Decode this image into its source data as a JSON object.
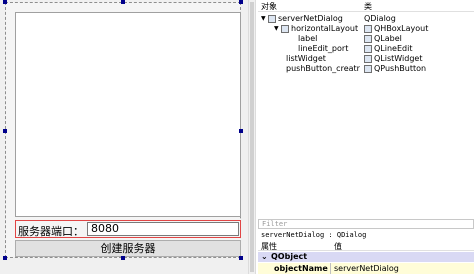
{
  "form": {
    "port_label": "服务器端口：",
    "port_value": "8080",
    "create_button": "创建服务器"
  },
  "object_inspector": {
    "col_object": "对象",
    "col_class": "类",
    "rows": [
      {
        "name": "serverNetDialog",
        "cls": "QDialog"
      },
      {
        "name": "horizontalLayout",
        "cls": "QHBoxLayout"
      },
      {
        "name": "label",
        "cls": "QLabel"
      },
      {
        "name": "lineEdit_port",
        "cls": "QLineEdit"
      },
      {
        "name": "listWidget",
        "cls": "QListWidget"
      },
      {
        "name": "pushButton_creatr",
        "cls": "QPushButton"
      }
    ]
  },
  "property_editor": {
    "filter_placeholder": "Filter",
    "class_line": "serverNetDialog : QDialog",
    "col_property": "属性",
    "col_value": "值",
    "group": "QObject",
    "group_expander": "⌄",
    "rows": [
      {
        "name": "objectName",
        "value": "serverNetDialog"
      }
    ]
  },
  "colors": {
    "selection_highlight": "#e04545",
    "group_background": "#d9d9f4",
    "property_row_background": "#fffdd8",
    "handle_color": "#00008b"
  }
}
